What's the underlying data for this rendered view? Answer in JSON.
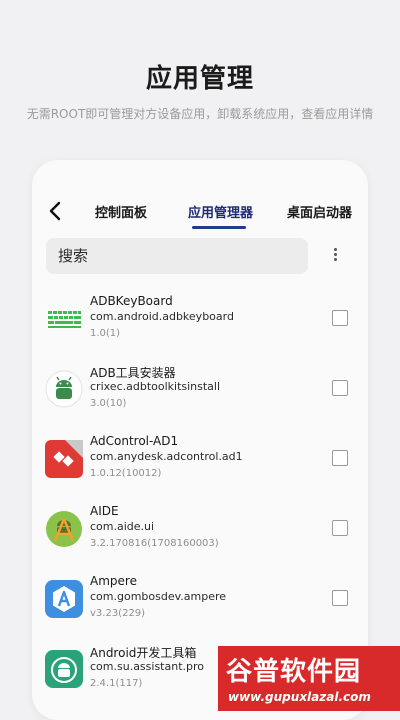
{
  "hero": {
    "title": "应用管理",
    "subtitle": "无需ROOT即可管理对方设备应用，卸载系统应用，查看应用详情"
  },
  "tabs": [
    {
      "label": "控制面板",
      "active": false
    },
    {
      "label": "应用管理器",
      "active": true
    },
    {
      "label": "桌面启动器",
      "active": false
    }
  ],
  "search": {
    "placeholder": "搜索",
    "value": ""
  },
  "apps": [
    {
      "name": "ADBKeyBoard",
      "package": "com.android.adbkeyboard",
      "version": "1.0(1)",
      "icon": "keyboard-icon",
      "checked": false
    },
    {
      "name": "ADB工具安装器",
      "package": "crixec.adbtoolkitsinstall",
      "version": "3.0(10)",
      "icon": "android-robot-icon",
      "checked": false
    },
    {
      "name": "AdControl-AD1",
      "package": "com.anydesk.adcontrol.ad1",
      "version": "1.0.12(10012)",
      "icon": "anydesk-icon",
      "checked": false
    },
    {
      "name": "AIDE",
      "package": "com.aide.ui",
      "version": "3.2.170816(1708160003)",
      "icon": "aide-icon",
      "checked": false
    },
    {
      "name": "Ampere",
      "package": "com.gombosdev.ampere",
      "version": "v3.23(229)",
      "icon": "ampere-icon",
      "checked": false
    },
    {
      "name": "Android开发工具箱",
      "package": "com.su.assistant.pro",
      "version": "2.4.1(117)",
      "icon": "android-toolbox-icon",
      "checked": false
    }
  ],
  "watermark": {
    "title": "谷普软件园",
    "url": "www.gupuxlazal.com"
  },
  "colors": {
    "accent": "#263a8a",
    "page_bg": "#f1f1f3",
    "card_bg": "#fafafa",
    "watermark": "#d82a2a"
  }
}
